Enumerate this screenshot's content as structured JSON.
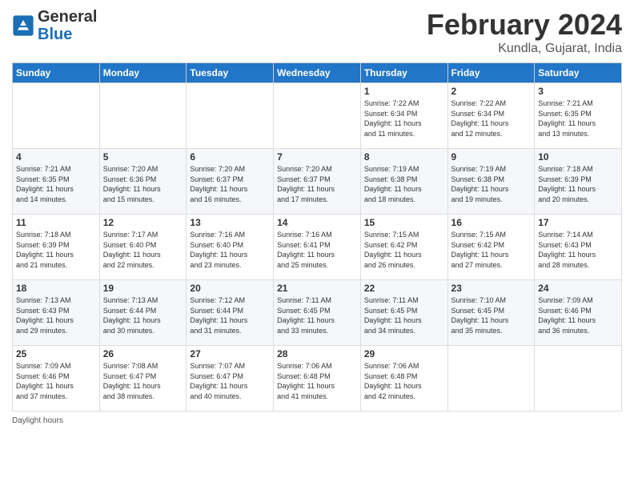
{
  "header": {
    "logo_general": "General",
    "logo_blue": "Blue",
    "month_title": "February 2024",
    "location": "Kundla, Gujarat, India"
  },
  "weekdays": [
    "Sunday",
    "Monday",
    "Tuesday",
    "Wednesday",
    "Thursday",
    "Friday",
    "Saturday"
  ],
  "footer": {
    "daylight_label": "Daylight hours"
  },
  "weeks": [
    [
      {
        "day": "",
        "info": ""
      },
      {
        "day": "",
        "info": ""
      },
      {
        "day": "",
        "info": ""
      },
      {
        "day": "",
        "info": ""
      },
      {
        "day": "1",
        "info": "Sunrise: 7:22 AM\nSunset: 6:34 PM\nDaylight: 11 hours\nand 11 minutes."
      },
      {
        "day": "2",
        "info": "Sunrise: 7:22 AM\nSunset: 6:34 PM\nDaylight: 11 hours\nand 12 minutes."
      },
      {
        "day": "3",
        "info": "Sunrise: 7:21 AM\nSunset: 6:35 PM\nDaylight: 11 hours\nand 13 minutes."
      }
    ],
    [
      {
        "day": "4",
        "info": "Sunrise: 7:21 AM\nSunset: 6:35 PM\nDaylight: 11 hours\nand 14 minutes."
      },
      {
        "day": "5",
        "info": "Sunrise: 7:20 AM\nSunset: 6:36 PM\nDaylight: 11 hours\nand 15 minutes."
      },
      {
        "day": "6",
        "info": "Sunrise: 7:20 AM\nSunset: 6:37 PM\nDaylight: 11 hours\nand 16 minutes."
      },
      {
        "day": "7",
        "info": "Sunrise: 7:20 AM\nSunset: 6:37 PM\nDaylight: 11 hours\nand 17 minutes."
      },
      {
        "day": "8",
        "info": "Sunrise: 7:19 AM\nSunset: 6:38 PM\nDaylight: 11 hours\nand 18 minutes."
      },
      {
        "day": "9",
        "info": "Sunrise: 7:19 AM\nSunset: 6:38 PM\nDaylight: 11 hours\nand 19 minutes."
      },
      {
        "day": "10",
        "info": "Sunrise: 7:18 AM\nSunset: 6:39 PM\nDaylight: 11 hours\nand 20 minutes."
      }
    ],
    [
      {
        "day": "11",
        "info": "Sunrise: 7:18 AM\nSunset: 6:39 PM\nDaylight: 11 hours\nand 21 minutes."
      },
      {
        "day": "12",
        "info": "Sunrise: 7:17 AM\nSunset: 6:40 PM\nDaylight: 11 hours\nand 22 minutes."
      },
      {
        "day": "13",
        "info": "Sunrise: 7:16 AM\nSunset: 6:40 PM\nDaylight: 11 hours\nand 23 minutes."
      },
      {
        "day": "14",
        "info": "Sunrise: 7:16 AM\nSunset: 6:41 PM\nDaylight: 11 hours\nand 25 minutes."
      },
      {
        "day": "15",
        "info": "Sunrise: 7:15 AM\nSunset: 6:42 PM\nDaylight: 11 hours\nand 26 minutes."
      },
      {
        "day": "16",
        "info": "Sunrise: 7:15 AM\nSunset: 6:42 PM\nDaylight: 11 hours\nand 27 minutes."
      },
      {
        "day": "17",
        "info": "Sunrise: 7:14 AM\nSunset: 6:43 PM\nDaylight: 11 hours\nand 28 minutes."
      }
    ],
    [
      {
        "day": "18",
        "info": "Sunrise: 7:13 AM\nSunset: 6:43 PM\nDaylight: 11 hours\nand 29 minutes."
      },
      {
        "day": "19",
        "info": "Sunrise: 7:13 AM\nSunset: 6:44 PM\nDaylight: 11 hours\nand 30 minutes."
      },
      {
        "day": "20",
        "info": "Sunrise: 7:12 AM\nSunset: 6:44 PM\nDaylight: 11 hours\nand 31 minutes."
      },
      {
        "day": "21",
        "info": "Sunrise: 7:11 AM\nSunset: 6:45 PM\nDaylight: 11 hours\nand 33 minutes."
      },
      {
        "day": "22",
        "info": "Sunrise: 7:11 AM\nSunset: 6:45 PM\nDaylight: 11 hours\nand 34 minutes."
      },
      {
        "day": "23",
        "info": "Sunrise: 7:10 AM\nSunset: 6:45 PM\nDaylight: 11 hours\nand 35 minutes."
      },
      {
        "day": "24",
        "info": "Sunrise: 7:09 AM\nSunset: 6:46 PM\nDaylight: 11 hours\nand 36 minutes."
      }
    ],
    [
      {
        "day": "25",
        "info": "Sunrise: 7:09 AM\nSunset: 6:46 PM\nDaylight: 11 hours\nand 37 minutes."
      },
      {
        "day": "26",
        "info": "Sunrise: 7:08 AM\nSunset: 6:47 PM\nDaylight: 11 hours\nand 38 minutes."
      },
      {
        "day": "27",
        "info": "Sunrise: 7:07 AM\nSunset: 6:47 PM\nDaylight: 11 hours\nand 40 minutes."
      },
      {
        "day": "28",
        "info": "Sunrise: 7:06 AM\nSunset: 6:48 PM\nDaylight: 11 hours\nand 41 minutes."
      },
      {
        "day": "29",
        "info": "Sunrise: 7:06 AM\nSunset: 6:48 PM\nDaylight: 11 hours\nand 42 minutes."
      },
      {
        "day": "",
        "info": ""
      },
      {
        "day": "",
        "info": ""
      }
    ]
  ]
}
